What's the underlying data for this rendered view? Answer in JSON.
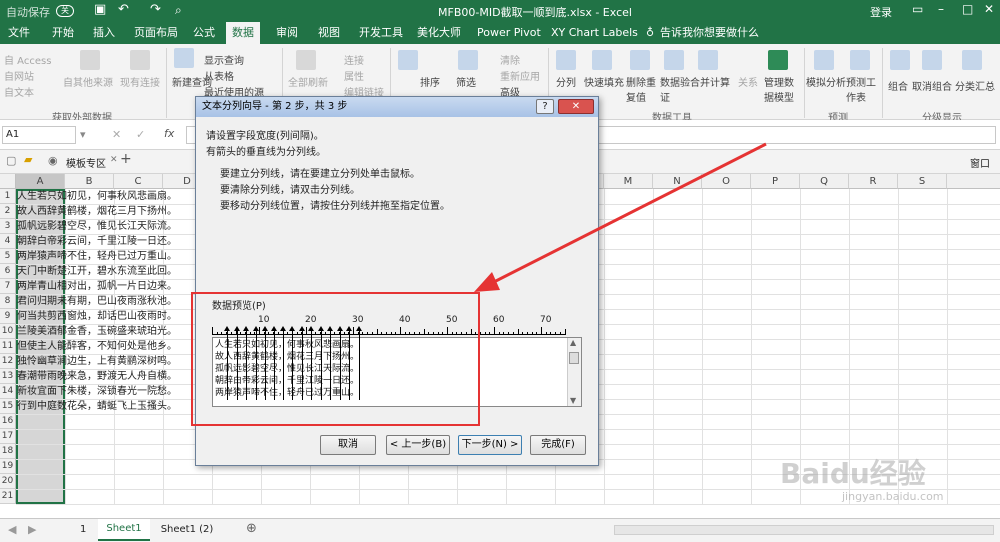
{
  "titlebar": {
    "autosave": "自动保存",
    "off": "关",
    "filename": "MFB00-MID截取一顺到底.xlsx - Excel",
    "login": "登录"
  },
  "menu": [
    "文件",
    "开始",
    "插入",
    "页面布局",
    "公式",
    "数据",
    "审阅",
    "视图",
    "开发工具",
    "美化大师",
    "Power Pivot",
    "XY Chart Labels",
    "告诉我你想要做什么"
  ],
  "menu_active": "数据",
  "ribbon": {
    "access": "自 Access",
    "web": "自网站",
    "text": "自文本",
    "other": "自其他来源",
    "existing": "现有连接",
    "group1": "获取外部数据",
    "newquery": "新建查询",
    "showq": "显示查询",
    "fromtable": "从表格",
    "recent": "最近使用的源",
    "refresh": "全部刷新",
    "conn": "连接",
    "props": "属性",
    "editlinks": "编辑链接",
    "sort": "排序",
    "filter": "筛选",
    "clear": "清除",
    "reapply": "重新应用",
    "adv": "高级",
    "split": "分列",
    "flash": "快速填充",
    "dup": "删除重复值",
    "valid": "数据验证",
    "consol": "合并计算",
    "rel": "关系",
    "model": "管理数据模型",
    "group5": "数据工具",
    "whatif": "模拟分析",
    "forecast": "预测工作表",
    "group6": "预测",
    "grp": "组合",
    "ungrp": "取消组合",
    "subtotal": "分类汇总",
    "group7": "分级显示"
  },
  "formula": {
    "namebox": "A1",
    "fx": "fx"
  },
  "workbar": {
    "tab": "模板专区",
    "window": "窗口"
  },
  "columns": [
    "A",
    "B",
    "C",
    "D",
    "E",
    "F",
    "G",
    "H",
    "I",
    "J",
    "K",
    "L",
    "M",
    "N",
    "O",
    "P",
    "Q",
    "R",
    "S"
  ],
  "rows": [
    "人生若只如初见，何事秋风悲画扇。",
    "故人西辞黄鹤楼，烟花三月下扬州。",
    "孤帆远影碧空尽，惟见长江天际流。",
    "朝辞白帝彩云间，千里江陵一日还。",
    "两岸猿声啼不住，轻舟已过万重山。",
    "天门中断楚江开，碧水东流至此回。",
    "两岸青山相对出，孤帆一片日边来。",
    "君问归期未有期，巴山夜雨涨秋池。",
    "何当共剪西窗烛，却话巴山夜雨时。",
    "兰陵美酒郁金香，玉碗盛来琥珀光。",
    "但使主人能醉客，不知何处是他乡。",
    "独怜幽草涧边生，上有黄鹂深树鸣。",
    "春潮带雨晚来急，野渡无人舟自横。",
    "新妆宜面下朱楼，深锁春光一院愁。",
    "行到中庭数花朵，蜻蜓飞上玉搔头。"
  ],
  "extra_rows": [
    "16",
    "17",
    "18",
    "19",
    "20",
    "21"
  ],
  "sheets": {
    "s1": "Sheet1",
    "s2": "Sheet1 (2)",
    "num": "1"
  },
  "dialog": {
    "title": "文本分列向导 - 第 2 步，共 3 步",
    "help": "?",
    "line1": "请设置字段宽度(列间隔)。",
    "line2": "有箭头的垂直线为分列线。",
    "i1": "要建立分列线，请在要建立分列处单击鼠标。",
    "i2": "要清除分列线，请双击分列线。",
    "i3": "要移动分列线位置，请按住分列线并拖至指定位置。",
    "preview_label": "数据预览(P)",
    "ruler": [
      "10",
      "20",
      "30",
      "40",
      "50",
      "60",
      "70"
    ],
    "preview_rows": [
      "人生若只如初见，何事秋风悲画扇。",
      "故人西辞黄鹤楼，烟花三月下扬州。",
      "孤帆远影碧空尽，惟见长江天际流。",
      "朝辞白帝彩云间，千里江陵一日还。",
      "两岸猿声啼不住，轻舟已过万重山。"
    ],
    "cancel": "取消",
    "back": "< 上一步(B)",
    "next": "下一步(N) >",
    "finish": "完成(F)"
  },
  "watermark": {
    "brand": "Baidu经验",
    "url": "jingyan.baidu.com"
  },
  "colors": {
    "excel_green": "#217346",
    "annotation_red": "#e53333"
  }
}
